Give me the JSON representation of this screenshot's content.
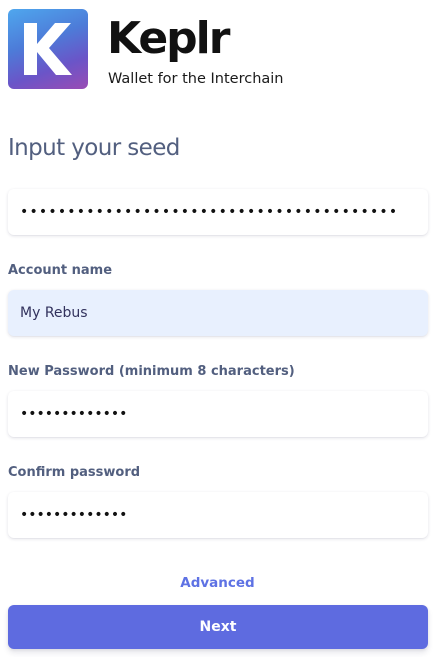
{
  "brand": {
    "logo_letter": "K",
    "name": "Keplr",
    "tagline": "Wallet for the Interchain"
  },
  "page": {
    "title": "Input your seed"
  },
  "form": {
    "seed_masked": "••••••••••••••••••••••••••••••••••••••••",
    "account_name_label": "Account name",
    "account_name_value": "My Rebus",
    "password_label": "New Password (minimum 8 characters)",
    "password_masked": "•••••••••••••",
    "confirm_label": "Confirm password",
    "confirm_masked": "•••••••••••••"
  },
  "actions": {
    "advanced_label": "Advanced",
    "next_label": "Next"
  },
  "colors": {
    "accent": "#5e72e4",
    "button": "#5e6be0",
    "autofill_bg": "#e8f0fe"
  }
}
